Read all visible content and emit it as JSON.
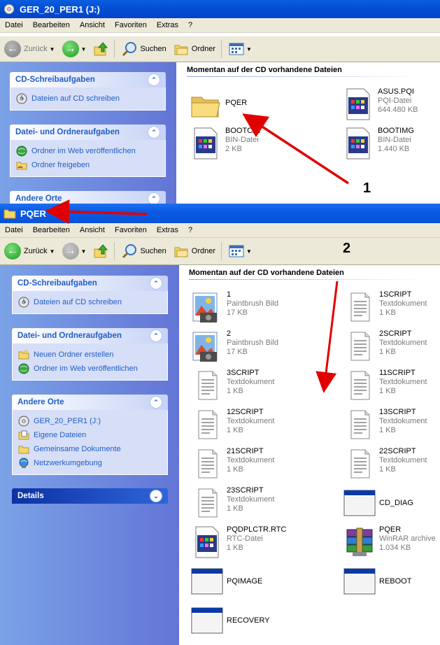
{
  "window1": {
    "title": "GER_20_PER1 (J:)",
    "menu": [
      "Datei",
      "Bearbeiten",
      "Ansicht",
      "Favoriten",
      "Extras",
      "?"
    ],
    "toolbar": {
      "back": "Zurück",
      "search": "Suchen",
      "folders": "Ordner"
    },
    "panels": {
      "cd_tasks": {
        "title": "CD-Schreibaufgaben",
        "items": [
          "Dateien auf CD schreiben"
        ]
      },
      "file_tasks": {
        "title": "Datei- und Ordneraufgaben",
        "items": [
          "Ordner im Web veröffentlichen",
          "Ordner freigeben"
        ]
      },
      "other_places": {
        "title": "Andere Orte"
      }
    },
    "content_title": "Momentan auf der CD vorhandene Dateien",
    "files": [
      {
        "name": "PQER",
        "type": "",
        "size": "",
        "icon": "folder-icon"
      },
      {
        "name": "ASUS.PQI",
        "type": "PQI-Datei",
        "size": "644.480 KB",
        "icon": "file-icon"
      },
      {
        "name": "BOOTCAT",
        "type": "BIN-Datei",
        "size": "2 KB",
        "icon": "file-icon"
      },
      {
        "name": "BOOTIMG",
        "type": "BIN-Datei",
        "size": "1.440 KB",
        "icon": "file-icon"
      }
    ]
  },
  "window2": {
    "title": "PQER",
    "menu": [
      "Datei",
      "Bearbeiten",
      "Ansicht",
      "Favoriten",
      "Extras",
      "?"
    ],
    "toolbar": {
      "back": "Zurück",
      "search": "Suchen",
      "folders": "Ordner"
    },
    "panels": {
      "cd_tasks": {
        "title": "CD-Schreibaufgaben",
        "items": [
          "Dateien auf CD schreiben"
        ]
      },
      "file_tasks": {
        "title": "Datei- und Ordneraufgaben",
        "items": [
          "Neuen Ordner erstellen",
          "Ordner im Web veröffentlichen"
        ]
      },
      "other_places": {
        "title": "Andere Orte",
        "items": [
          "GER_20_PER1 (J:)",
          "Eigene Dateien",
          "Gemeinsame Dokumente",
          "Netzwerkumgebung"
        ]
      },
      "details": {
        "title": "Details"
      }
    },
    "content_title": "Momentan auf der CD vorhandene Dateien",
    "files_left": [
      {
        "name": "1",
        "type": "Paintbrush Bild",
        "size": "17 KB",
        "icon": "paint-image-icon"
      },
      {
        "name": "2",
        "type": "Paintbrush Bild",
        "size": "17 KB",
        "icon": "paint-image-icon"
      },
      {
        "name": "3SCRIPT",
        "type": "Textdokument",
        "size": "1 KB",
        "icon": "text-document-icon"
      },
      {
        "name": "12SCRIPT",
        "type": "Textdokument",
        "size": "1 KB",
        "icon": "text-document-icon"
      },
      {
        "name": "21SCRIPT",
        "type": "Textdokument",
        "size": "1 KB",
        "icon": "text-document-icon"
      },
      {
        "name": "23SCRIPT",
        "type": "Textdokument",
        "size": "1 KB",
        "icon": "text-document-icon"
      },
      {
        "name": "PQDPLCTR.RTC",
        "type": "RTC-Datei",
        "size": "1 KB",
        "icon": "file-icon"
      },
      {
        "name": "PQIMAGE",
        "type": "",
        "size": "",
        "icon": "application-icon"
      },
      {
        "name": "RECOVERY",
        "type": "",
        "size": "",
        "icon": "application-icon"
      }
    ],
    "files_right": [
      {
        "name": "1SCRIPT",
        "type": "Textdokument",
        "size": "1 KB",
        "icon": "text-document-icon"
      },
      {
        "name": "2SCRIPT",
        "type": "Textdokument",
        "size": "1 KB",
        "icon": "text-document-icon"
      },
      {
        "name": "11SCRIPT",
        "type": "Textdokument",
        "size": "1 KB",
        "icon": "text-document-icon"
      },
      {
        "name": "13SCRIPT",
        "type": "Textdokument",
        "size": "1 KB",
        "icon": "text-document-icon"
      },
      {
        "name": "22SCRIPT",
        "type": "Textdokument",
        "size": "1 KB",
        "icon": "text-document-icon"
      },
      {
        "name": "CD_DIAG",
        "type": "",
        "size": "",
        "icon": "application-icon"
      },
      {
        "name": "PQER",
        "type": "WinRAR archive",
        "size": "1.034 KB",
        "icon": "winrar-archive-icon"
      },
      {
        "name": "REBOOT",
        "type": "",
        "size": "",
        "icon": "application-icon"
      }
    ]
  },
  "annotations": {
    "step1": "1",
    "step2": "2",
    "arrow_color": "#e00000"
  }
}
